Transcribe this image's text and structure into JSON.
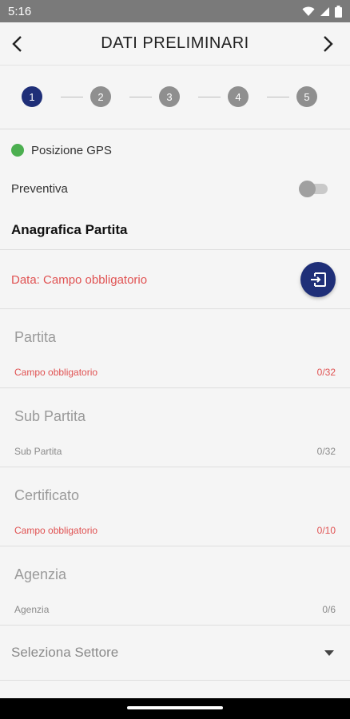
{
  "status_bar": {
    "time": "5:16"
  },
  "app_bar": {
    "title": "DATI PRELIMINARI"
  },
  "stepper": {
    "steps": [
      "1",
      "2",
      "3",
      "4",
      "5"
    ],
    "active_index": 0
  },
  "gps": {
    "label": "Posizione GPS",
    "status_color": "#4caf50"
  },
  "preventiva": {
    "label": "Preventiva",
    "checked": false
  },
  "section": {
    "title": "Anagrafica Partita"
  },
  "date": {
    "error": "Data: Campo obbligatorio"
  },
  "fields": {
    "partita": {
      "label": "Partita",
      "helper": "Campo obbligatorio",
      "counter": "0/32"
    },
    "sub_partita": {
      "label": "Sub Partita",
      "helper": "Sub Partita",
      "counter": "0/32"
    },
    "certificato": {
      "label": "Certificato",
      "helper": "Campo obbligatorio",
      "counter": "0/10"
    },
    "agenzia": {
      "label": "Agenzia",
      "helper": "Agenzia",
      "counter": "0/6"
    }
  },
  "settore": {
    "label": "Seleziona Settore"
  },
  "colors": {
    "accent": "#1f2f78",
    "error": "#e05252"
  }
}
